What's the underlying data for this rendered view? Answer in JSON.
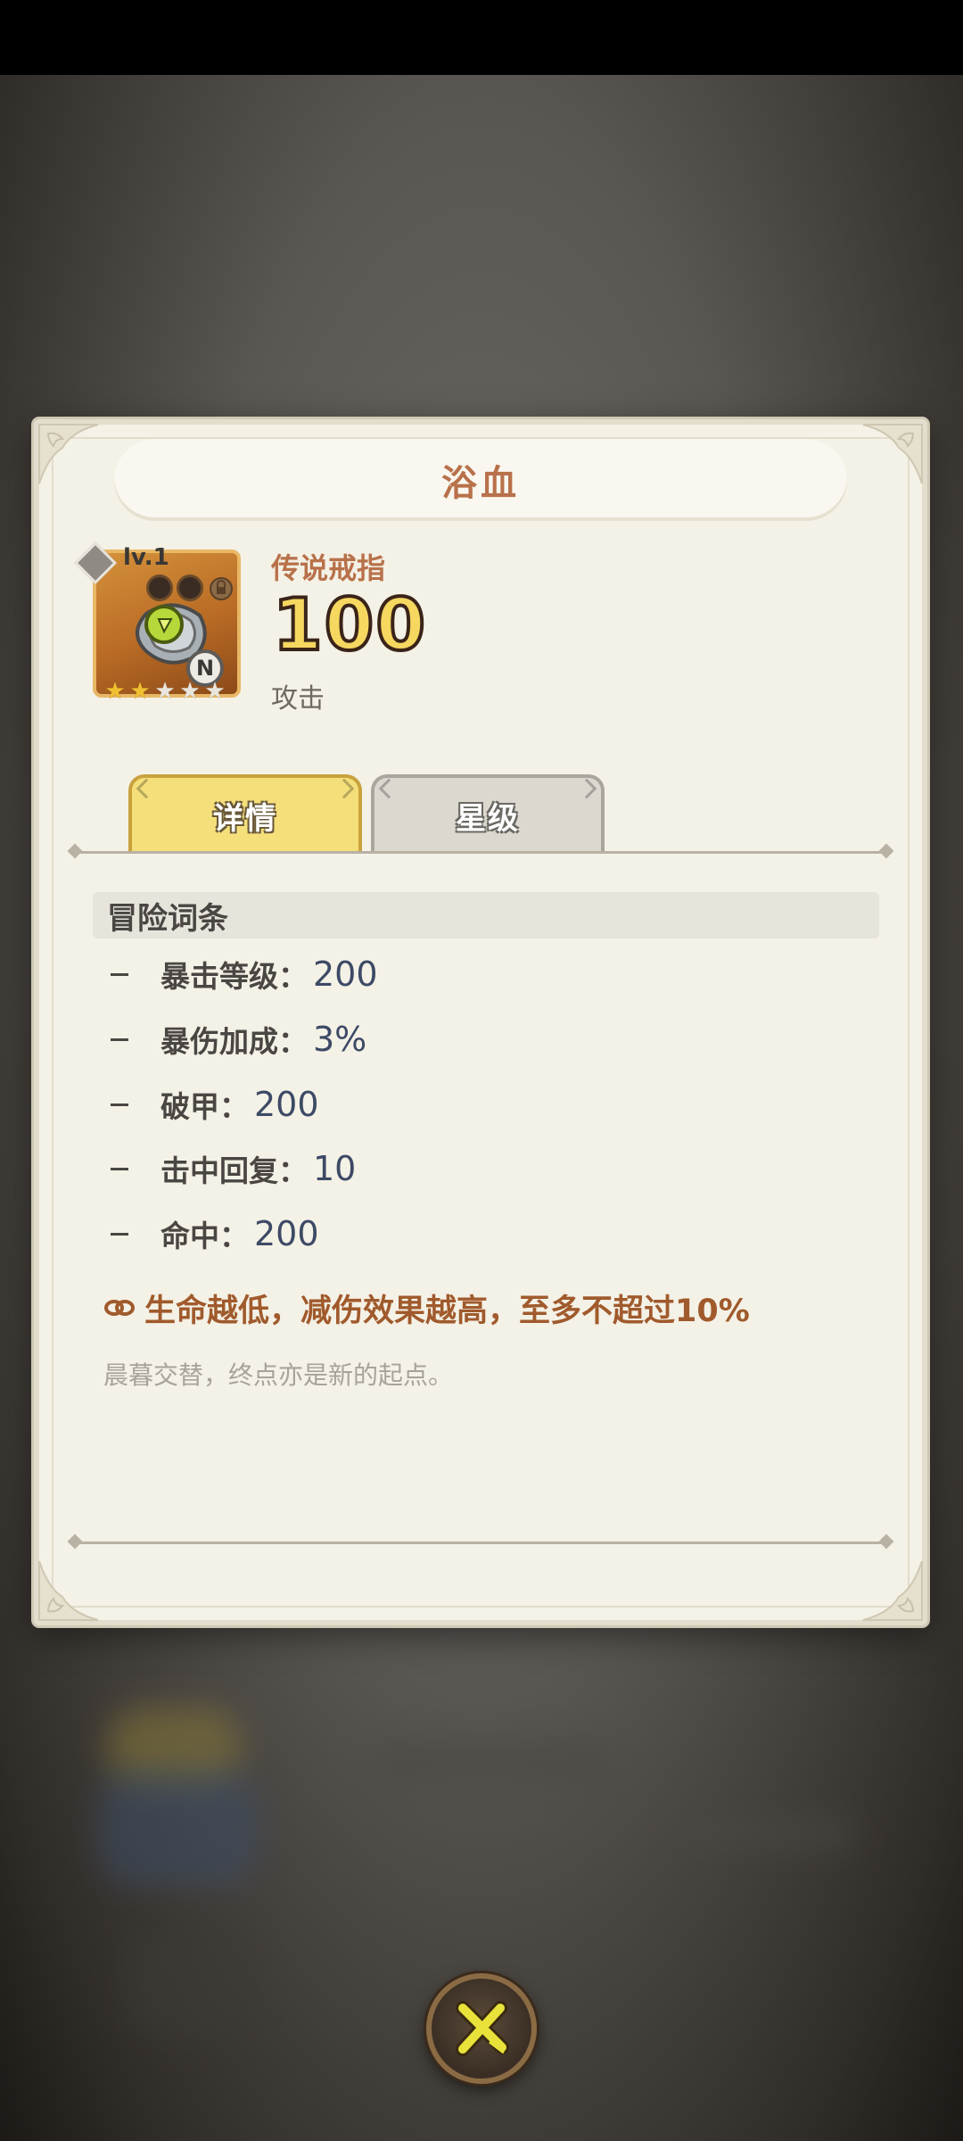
{
  "dialog": {
    "title": "浴血"
  },
  "item": {
    "level": "lv.1",
    "grade": "N",
    "stars_filled": 2,
    "stars_total": 5,
    "name": "传说戒指",
    "value": "100",
    "stat_label": "攻击"
  },
  "tabs": [
    {
      "label": "详情",
      "active": true
    },
    {
      "label": "星级",
      "active": false
    }
  ],
  "section": {
    "title": "冒险词条"
  },
  "attributes": [
    {
      "name": "暴击等级：",
      "value": "200"
    },
    {
      "name": "暴伤加成：",
      "value": "3%"
    },
    {
      "name": "破甲：",
      "value": "200"
    },
    {
      "name": "击中回复：",
      "value": "10"
    },
    {
      "name": "命中：",
      "value": "200"
    }
  ],
  "passive": {
    "text": "生命越低，减伤效果越高，至多不超过10%"
  },
  "flavor_text": "晨暮交替，终点亦是新的起点。",
  "colors": {
    "title": "#b8714a",
    "value_fill": "#f6d760",
    "passive": "#a05a2c",
    "active_tab": "#f4df7a",
    "close_x": "#e8e23a"
  },
  "icons": {
    "close": "close-x-icon",
    "link": "link-icon",
    "level": "diamond-icon",
    "lock": "lock-icon",
    "ring": "ring-icon"
  }
}
